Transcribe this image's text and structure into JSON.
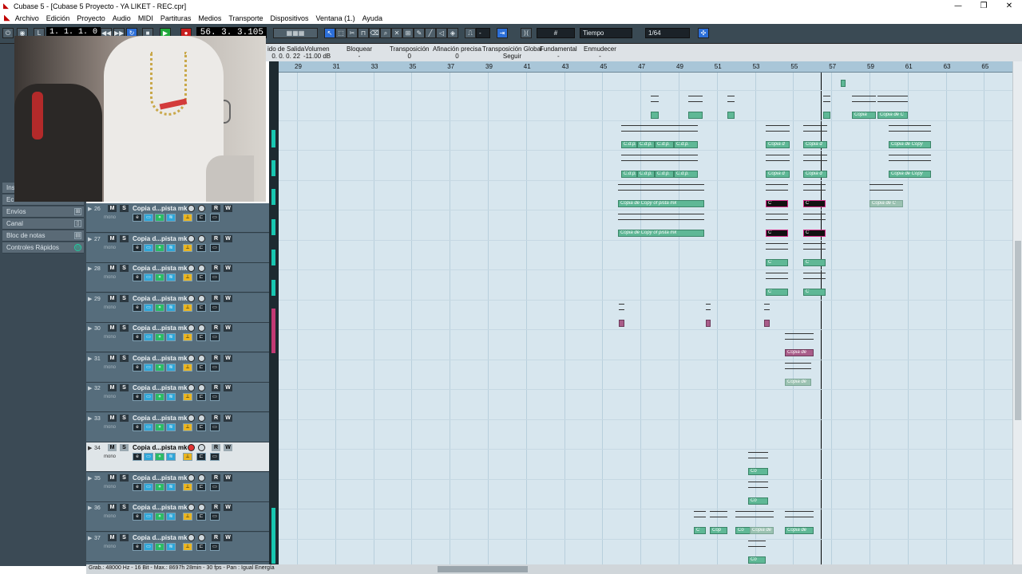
{
  "window": {
    "title": "Cubase 5 - [Cubase 5 Proyecto - YA LIKET - REC.cpr]",
    "min": "—",
    "max": "❐",
    "close": "✕"
  },
  "menu": [
    "Archivo",
    "Edición",
    "Proyecto",
    "Audio",
    "MIDI",
    "Partituras",
    "Medios",
    "Transporte",
    "Dispositivos",
    "Ventana (1.)",
    "Ayuda"
  ],
  "transport": {
    "left_locator": "1. 1. 1.  0",
    "position": "56. 3. 3.105"
  },
  "toolbar": {
    "snap_mode": "Tiempo",
    "quantize": "1/64",
    "grid_icon": "#",
    "colors": {
      "accent": "#2c6fd8",
      "play": "#1ea83a",
      "rec": "#c81e1e",
      "event": "#5fb896"
    }
  },
  "infoline": [
    {
      "label": "ido de Salida",
      "value": "0. 0. 0. 22"
    },
    {
      "label": "Volumen",
      "value": "-11.00 dB"
    },
    {
      "label": "Bloquear",
      "value": "-"
    },
    {
      "label": "Transposición",
      "value": "0"
    },
    {
      "label": "Afinación precisa",
      "value": "0"
    },
    {
      "label": "Transposición Global",
      "value": "Seguir"
    },
    {
      "label": "Fundamental",
      "value": "-"
    },
    {
      "label": "Enmudecer",
      "value": "-"
    }
  ],
  "inspector": {
    "items": [
      {
        "label": "Ins"
      },
      {
        "label": "Ec"
      },
      {
        "label": "Envíos"
      },
      {
        "label": "Canal"
      },
      {
        "label": "Bloc de notas"
      },
      {
        "label": "Controles Rápidos"
      }
    ]
  },
  "ruler": [
    "29",
    "31",
    "33",
    "35",
    "37",
    "39",
    "41",
    "43",
    "45",
    "47",
    "49",
    "51",
    "53",
    "55",
    "57",
    "59",
    "61",
    "63",
    "65"
  ],
  "tracks": [
    {
      "num": "26",
      "name": "Copia d...pista mk",
      "mono": "mono"
    },
    {
      "num": "27",
      "name": "Copia d...pista mk",
      "mono": "mono"
    },
    {
      "num": "28",
      "name": "Copia d...pista mk",
      "mono": "mono"
    },
    {
      "num": "29",
      "name": "Copia d...pista mk",
      "mono": "mono"
    },
    {
      "num": "30",
      "name": "Copia d...pista mk",
      "mono": "mono"
    },
    {
      "num": "31",
      "name": "Copia d...pista mk",
      "mono": "mono"
    },
    {
      "num": "32",
      "name": "Copia d...pista mk",
      "mono": "mono"
    },
    {
      "num": "33",
      "name": "Copia d...pista mk",
      "mono": "mono"
    },
    {
      "num": "34",
      "name": "Copia d...pista mk",
      "mono": "mono"
    },
    {
      "num": "35",
      "name": "Copia d...pista mk",
      "mono": "mono"
    },
    {
      "num": "36",
      "name": "Copia d...pista mk",
      "mono": "mono"
    },
    {
      "num": "37",
      "name": "Copia d...pista mk",
      "mono": "mono"
    }
  ],
  "track_buttons": {
    "mute": "M",
    "solo": "S",
    "read": "R",
    "write": "W",
    "edit": "e"
  },
  "events": {
    "copia_de": "Copia de",
    "copia_de_copy": "Copia de Copy",
    "copia_de_copy_pista": "Copia de Copy of pista mk",
    "c": "C",
    "co": "Co",
    "cop": "Cop",
    "copia": "Copia",
    "copia_d": "Copia d",
    "copia_de_cop": "Copia de Cop",
    "copia_de_c": "Copia de C",
    "cdp": "C.d.p."
  },
  "status": "Grab.: 48000 Hz - 16 Bit - Max.: 8697h 28min - 30 fps - Pan : Igual Energía"
}
